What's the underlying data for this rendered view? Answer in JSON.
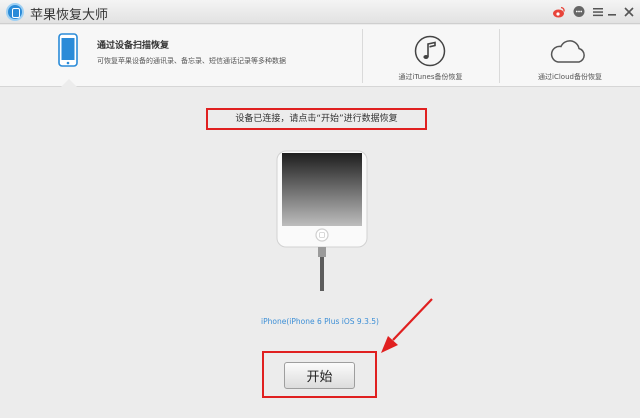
{
  "window": {
    "title": "苹果恢复大师"
  },
  "titlebar_icons": [
    "weibo-icon",
    "chat-icon",
    "menu-icon",
    "minimize-icon",
    "close-icon"
  ],
  "tabs": {
    "scan": {
      "title": "通过设备扫描恢复",
      "description": "可恢复苹果设备的通讯录、备忘录、短信通话记录等多种数据"
    },
    "itunes": {
      "label": "通过iTunes备份恢复"
    },
    "icloud": {
      "label": "通过iCloud备份恢复"
    }
  },
  "main": {
    "status": "设备已连接，请点击“开始”进行数据恢复",
    "device_name": "iPhone(iPhone 6 Plus iOS 9.3.5)",
    "start_label": "开始"
  },
  "colors": {
    "highlight": "#e02020",
    "link": "#3d8fd6",
    "accent": "#2a8bd8"
  }
}
